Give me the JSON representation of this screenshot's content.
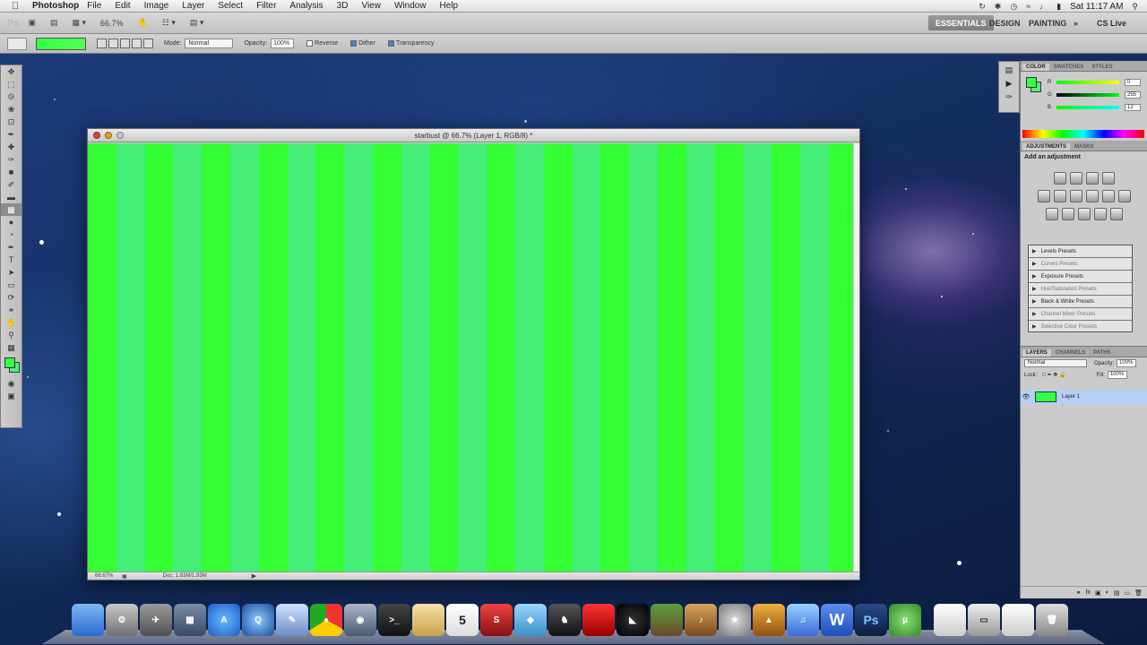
{
  "menubar": {
    "app_name": "Photoshop",
    "menus": [
      "File",
      "Edit",
      "Image",
      "Layer",
      "Select",
      "Filter",
      "Analysis",
      "3D",
      "View",
      "Window",
      "Help"
    ],
    "clock": "Sat 11:17 AM"
  },
  "appbar": {
    "logo": "Ps",
    "zoom": "66.7%",
    "workspaces": {
      "essentials": "ESSENTIALS",
      "design": "DESIGN",
      "painting": "PAINTING",
      "more": "»",
      "cslive": "CS Live"
    }
  },
  "options": {
    "mode_label": "Mode:",
    "mode_value": "Normal",
    "opacity_label": "Opacity:",
    "opacity_value": "100%",
    "reverse": "Reverse",
    "dither": "Dither",
    "transparency": "Transparency",
    "checked": {
      "reverse": false,
      "dither": true,
      "transparency": true
    }
  },
  "document": {
    "title": "starbust @ 66.7% (Layer 1, RGB/8) *",
    "zoom": "66.67%",
    "docinfo": "Doc: 1.93M/1.93M",
    "stripe_colors": [
      "#33ff33",
      "#44ee77"
    ]
  },
  "panels": {
    "color_tabs": [
      "COLOR",
      "SWATCHES",
      "STYLES"
    ],
    "color_values": {
      "r": "0",
      "g": "255",
      "b": "12"
    },
    "adjust_tabs": [
      "ADJUSTMENTS",
      "MASKS"
    ],
    "adjust_title": "Add an adjustment",
    "presets": [
      "Levels Presets",
      "Curves Presets",
      "Exposure Presets",
      "Hue/Saturation Presets",
      "Black & White Presets",
      "Channel Mixer Presets",
      "Selective Color Presets"
    ],
    "layers_tabs": [
      "LAYERS",
      "CHANNELS",
      "PATHS"
    ],
    "blend_mode": "Normal",
    "opacity_label": "Opacity:",
    "opacity_value": "100%",
    "lock_label": "Lock:",
    "fill_label": "Fill:",
    "fill_value": "100%",
    "layer_name": "Layer 1"
  },
  "dock": {
    "icons": [
      "finder-icon",
      "system-preferences-icon",
      "launchpad-icon",
      "utilities-icon",
      "app-store-icon",
      "quicktime-icon",
      "preview-icon",
      "chrome-icon",
      "photo-icon",
      "terminal-icon",
      "notes-icon",
      "calendar-icon",
      "serato-icon",
      "xcode-icon",
      "game-icon",
      "red-icon",
      "ninja-icon",
      "minecraft-icon",
      "garageband-icon",
      "imovie-icon",
      "iphoto-icon",
      "itunes-icon",
      "word-icon",
      "photoshop-icon",
      "utorrent-icon",
      "document-icon",
      "disk-icon",
      "file-icon",
      "trash-icon"
    ],
    "calendar_day": "5",
    "word_label": "W",
    "ps_label": "Ps"
  },
  "colors": {
    "canvas_bright": "#33ff33",
    "canvas_teal": "#44ee77",
    "essentials_bg": "#7c7c7c"
  }
}
